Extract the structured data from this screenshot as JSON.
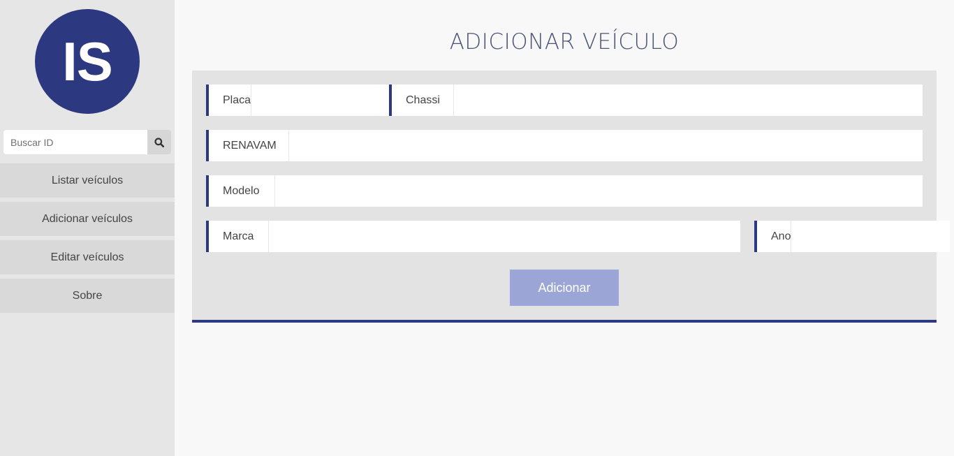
{
  "logo": {
    "initials": "IS",
    "color": "#2c3880"
  },
  "search": {
    "placeholder": "Buscar ID",
    "icon": "search-icon"
  },
  "nav": {
    "items": [
      {
        "label": "Listar veículos"
      },
      {
        "label": "Adicionar veículos"
      },
      {
        "label": "Editar veículos"
      },
      {
        "label": "Sobre"
      }
    ]
  },
  "page": {
    "title": "ADICIONAR VEÍCULO"
  },
  "form": {
    "placa": {
      "label": "Placa",
      "value": ""
    },
    "chassi": {
      "label": "Chassi",
      "value": ""
    },
    "renavam": {
      "label": "RENAVAM",
      "value": ""
    },
    "modelo": {
      "label": "Modelo",
      "value": ""
    },
    "marca": {
      "label": "Marca",
      "value": ""
    },
    "ano": {
      "label": "Ano",
      "value": ""
    },
    "submit_label": "Adicionar"
  },
  "colors": {
    "accent": "#2c3880",
    "button": "#9ca6d6",
    "sidebar_bg": "#e6e6e6",
    "panel_bg": "#e3e3e3"
  }
}
